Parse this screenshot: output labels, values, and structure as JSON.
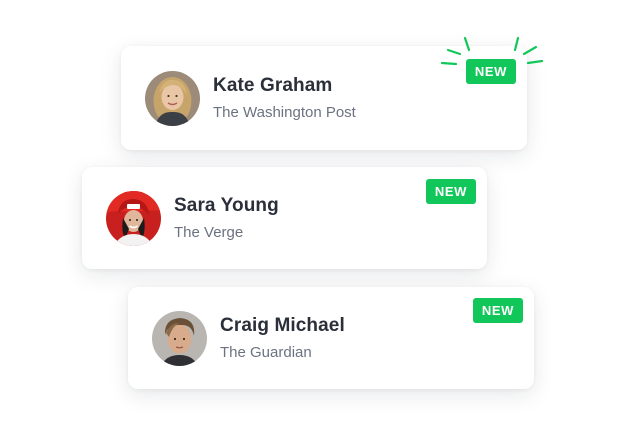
{
  "cards": [
    {
      "name": "Kate Graham",
      "outlet": "The Washington Post",
      "badge": "NEW",
      "avatar_icon": "person-avatar-woman-blonde"
    },
    {
      "name": "Sara Young",
      "outlet": "The Verge",
      "badge": "NEW",
      "avatar_icon": "person-avatar-woman-red-hat"
    },
    {
      "name": "Craig Michael",
      "outlet": "The Guardian",
      "badge": "NEW",
      "avatar_icon": "person-avatar-man"
    }
  ],
  "colors": {
    "badge": "#12c75a",
    "name_text": "#2a2f3a",
    "outlet_text": "#6b7280",
    "card_bg": "#ffffff"
  }
}
